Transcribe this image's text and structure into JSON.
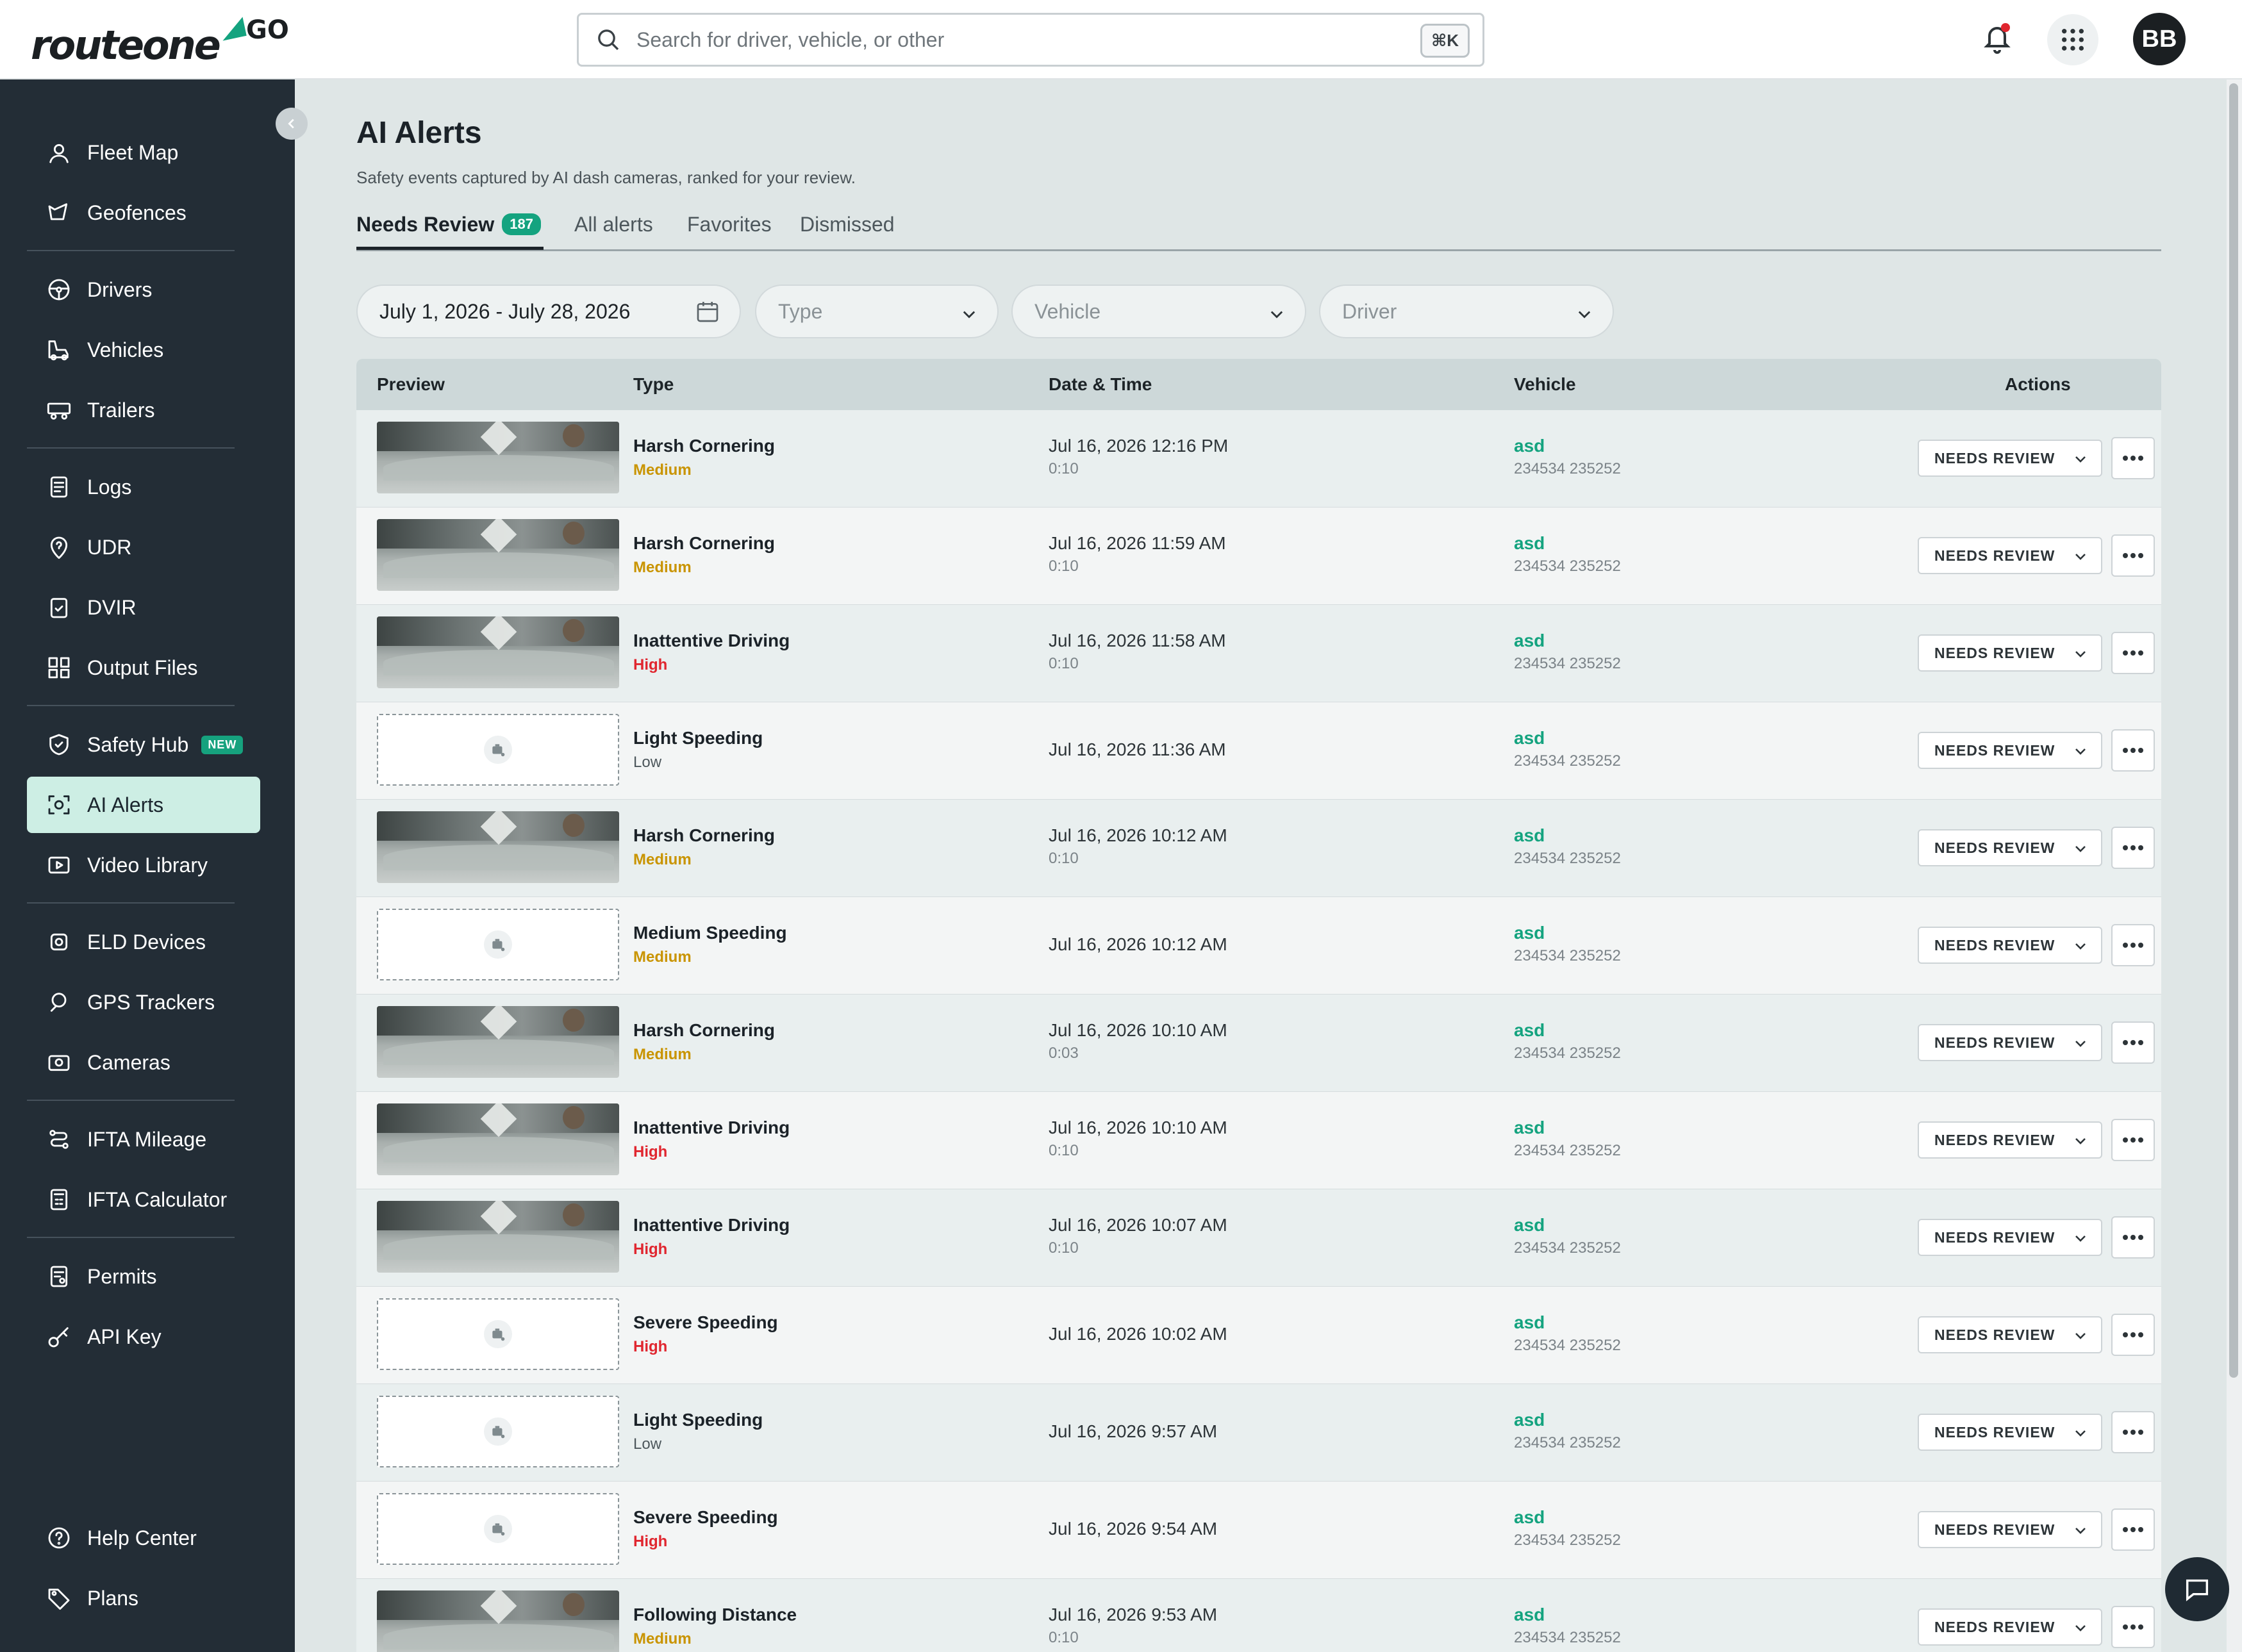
{
  "brand": {
    "logo_text": "routeone",
    "logo_suffix": "GO",
    "accent": "#14a37f"
  },
  "search": {
    "placeholder": "Search for driver, vehicle, or other",
    "shortcut": "⌘K"
  },
  "user": {
    "initials": "BB"
  },
  "sidebar": {
    "items": [
      {
        "label": "Fleet Map",
        "icon": "map-pin-icon"
      },
      {
        "label": "Geofences",
        "icon": "geofence-icon"
      },
      {
        "label": "Drivers",
        "icon": "steering-wheel-icon"
      },
      {
        "label": "Vehicles",
        "icon": "truck-icon"
      },
      {
        "label": "Trailers",
        "icon": "trailer-icon"
      },
      {
        "label": "Logs",
        "icon": "logs-icon"
      },
      {
        "label": "UDR",
        "icon": "question-pin-icon"
      },
      {
        "label": "DVIR",
        "icon": "clipboard-check-icon"
      },
      {
        "label": "Output Files",
        "icon": "files-grid-icon"
      },
      {
        "label": "Safety Hub",
        "icon": "shield-check-icon",
        "badge": "NEW"
      },
      {
        "label": "AI Alerts",
        "icon": "ai-camera-icon",
        "active": true
      },
      {
        "label": "Video Library",
        "icon": "video-play-icon"
      },
      {
        "label": "ELD Devices",
        "icon": "eld-device-icon"
      },
      {
        "label": "GPS Trackers",
        "icon": "gps-tracker-icon"
      },
      {
        "label": "Cameras",
        "icon": "camera-icon"
      },
      {
        "label": "IFTA Mileage",
        "icon": "route-icon"
      },
      {
        "label": "IFTA Calculator",
        "icon": "calculator-icon"
      },
      {
        "label": "Permits",
        "icon": "permit-icon"
      },
      {
        "label": "API Key",
        "icon": "key-icon"
      },
      {
        "label": "Help Center",
        "icon": "help-circle-icon"
      },
      {
        "label": "Plans",
        "icon": "tag-icon"
      }
    ]
  },
  "page": {
    "title": "AI Alerts",
    "subtitle": "Safety events captured by AI dash cameras, ranked for your review."
  },
  "tabs": [
    {
      "label": "Needs Review",
      "count": "187",
      "active": true
    },
    {
      "label": "All alerts"
    },
    {
      "label": "Favorites"
    },
    {
      "label": "Dismissed"
    }
  ],
  "filters": {
    "date_range": "July 1, 2026 - July 28, 2026",
    "type_placeholder": "Type",
    "vehicle_placeholder": "Vehicle",
    "driver_placeholder": "Driver"
  },
  "table": {
    "columns": [
      "Preview",
      "Type",
      "Date & Time",
      "Vehicle",
      "Actions"
    ],
    "rows": [
      {
        "has_video": true,
        "type": "Harsh Cornering",
        "severity": "Medium",
        "datetime": "Jul 16, 2026 12:16 PM",
        "duration": "0:10",
        "vehicle": "asd",
        "vehicle_id": "234534 235252",
        "status": "NEEDS REVIEW"
      },
      {
        "has_video": true,
        "type": "Harsh Cornering",
        "severity": "Medium",
        "datetime": "Jul 16, 2026 11:59 AM",
        "duration": "0:10",
        "vehicle": "asd",
        "vehicle_id": "234534 235252",
        "status": "NEEDS REVIEW"
      },
      {
        "has_video": true,
        "type": "Inattentive Driving",
        "severity": "High",
        "datetime": "Jul 16, 2026 11:58 AM",
        "duration": "0:10",
        "vehicle": "asd",
        "vehicle_id": "234534 235252",
        "status": "NEEDS REVIEW"
      },
      {
        "has_video": false,
        "type": "Light Speeding",
        "severity": "Low",
        "datetime": "Jul 16, 2026 11:36 AM",
        "duration": "",
        "vehicle": "asd",
        "vehicle_id": "234534 235252",
        "status": "NEEDS REVIEW"
      },
      {
        "has_video": true,
        "type": "Harsh Cornering",
        "severity": "Medium",
        "datetime": "Jul 16, 2026 10:12 AM",
        "duration": "0:10",
        "vehicle": "asd",
        "vehicle_id": "234534 235252",
        "status": "NEEDS REVIEW"
      },
      {
        "has_video": false,
        "type": "Medium Speeding",
        "severity": "Medium",
        "datetime": "Jul 16, 2026 10:12 AM",
        "duration": "",
        "vehicle": "asd",
        "vehicle_id": "234534 235252",
        "status": "NEEDS REVIEW"
      },
      {
        "has_video": true,
        "type": "Harsh Cornering",
        "severity": "Medium",
        "datetime": "Jul 16, 2026 10:10 AM",
        "duration": "0:03",
        "vehicle": "asd",
        "vehicle_id": "234534 235252",
        "status": "NEEDS REVIEW"
      },
      {
        "has_video": true,
        "type": "Inattentive Driving",
        "severity": "High",
        "datetime": "Jul 16, 2026 10:10 AM",
        "duration": "0:10",
        "vehicle": "asd",
        "vehicle_id": "234534 235252",
        "status": "NEEDS REVIEW"
      },
      {
        "has_video": true,
        "type": "Inattentive Driving",
        "severity": "High",
        "datetime": "Jul 16, 2026 10:07 AM",
        "duration": "0:10",
        "vehicle": "asd",
        "vehicle_id": "234534 235252",
        "status": "NEEDS REVIEW"
      },
      {
        "has_video": false,
        "type": "Severe Speeding",
        "severity": "High",
        "datetime": "Jul 16, 2026 10:02 AM",
        "duration": "",
        "vehicle": "asd",
        "vehicle_id": "234534 235252",
        "status": "NEEDS REVIEW"
      },
      {
        "has_video": false,
        "type": "Light Speeding",
        "severity": "Low",
        "datetime": "Jul 16, 2026 9:57 AM",
        "duration": "",
        "vehicle": "asd",
        "vehicle_id": "234534 235252",
        "status": "NEEDS REVIEW"
      },
      {
        "has_video": false,
        "type": "Severe Speeding",
        "severity": "High",
        "datetime": "Jul 16, 2026 9:54 AM",
        "duration": "",
        "vehicle": "asd",
        "vehicle_id": "234534 235252",
        "status": "NEEDS REVIEW"
      },
      {
        "has_video": true,
        "type": "Following Distance",
        "severity": "Medium",
        "datetime": "Jul 16, 2026 9:53 AM",
        "duration": "0:10",
        "vehicle": "asd",
        "vehicle_id": "234534 235252",
        "status": "NEEDS REVIEW"
      }
    ]
  }
}
